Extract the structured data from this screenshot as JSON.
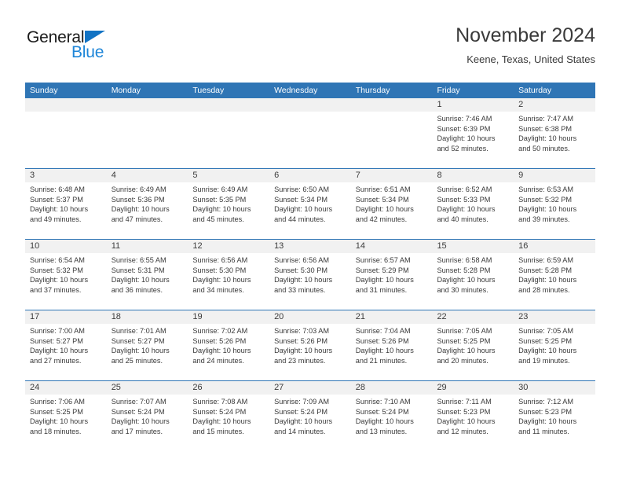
{
  "brand": {
    "name_dark": "General",
    "name_blue": "Blue",
    "triangle_color": "#1273c4",
    "blue_text_color": "#1f86d8"
  },
  "header": {
    "title": "November 2024",
    "subtitle": "Keene, Texas, United States"
  },
  "theme": {
    "header_blue": "#2f75b5",
    "day_band_gray": "#f1f1f1",
    "text_color": "#3a3a3a"
  },
  "weekday_headers": [
    "Sunday",
    "Monday",
    "Tuesday",
    "Wednesday",
    "Thursday",
    "Friday",
    "Saturday"
  ],
  "labels": {
    "sunrise_prefix": "Sunrise: ",
    "sunset_prefix": "Sunset: ",
    "daylight_prefix": "Daylight: "
  },
  "weeks": [
    [
      {
        "day": "",
        "empty": true
      },
      {
        "day": "",
        "empty": true
      },
      {
        "day": "",
        "empty": true
      },
      {
        "day": "",
        "empty": true
      },
      {
        "day": "",
        "empty": true
      },
      {
        "day": "1",
        "sunrise": "Sunrise: 7:46 AM",
        "sunset": "Sunset: 6:39 PM",
        "daylight": "Daylight: 10 hours and 52 minutes."
      },
      {
        "day": "2",
        "sunrise": "Sunrise: 7:47 AM",
        "sunset": "Sunset: 6:38 PM",
        "daylight": "Daylight: 10 hours and 50 minutes."
      }
    ],
    [
      {
        "day": "3",
        "sunrise": "Sunrise: 6:48 AM",
        "sunset": "Sunset: 5:37 PM",
        "daylight": "Daylight: 10 hours and 49 minutes."
      },
      {
        "day": "4",
        "sunrise": "Sunrise: 6:49 AM",
        "sunset": "Sunset: 5:36 PM",
        "daylight": "Daylight: 10 hours and 47 minutes."
      },
      {
        "day": "5",
        "sunrise": "Sunrise: 6:49 AM",
        "sunset": "Sunset: 5:35 PM",
        "daylight": "Daylight: 10 hours and 45 minutes."
      },
      {
        "day": "6",
        "sunrise": "Sunrise: 6:50 AM",
        "sunset": "Sunset: 5:34 PM",
        "daylight": "Daylight: 10 hours and 44 minutes."
      },
      {
        "day": "7",
        "sunrise": "Sunrise: 6:51 AM",
        "sunset": "Sunset: 5:34 PM",
        "daylight": "Daylight: 10 hours and 42 minutes."
      },
      {
        "day": "8",
        "sunrise": "Sunrise: 6:52 AM",
        "sunset": "Sunset: 5:33 PM",
        "daylight": "Daylight: 10 hours and 40 minutes."
      },
      {
        "day": "9",
        "sunrise": "Sunrise: 6:53 AM",
        "sunset": "Sunset: 5:32 PM",
        "daylight": "Daylight: 10 hours and 39 minutes."
      }
    ],
    [
      {
        "day": "10",
        "sunrise": "Sunrise: 6:54 AM",
        "sunset": "Sunset: 5:32 PM",
        "daylight": "Daylight: 10 hours and 37 minutes."
      },
      {
        "day": "11",
        "sunrise": "Sunrise: 6:55 AM",
        "sunset": "Sunset: 5:31 PM",
        "daylight": "Daylight: 10 hours and 36 minutes."
      },
      {
        "day": "12",
        "sunrise": "Sunrise: 6:56 AM",
        "sunset": "Sunset: 5:30 PM",
        "daylight": "Daylight: 10 hours and 34 minutes."
      },
      {
        "day": "13",
        "sunrise": "Sunrise: 6:56 AM",
        "sunset": "Sunset: 5:30 PM",
        "daylight": "Daylight: 10 hours and 33 minutes."
      },
      {
        "day": "14",
        "sunrise": "Sunrise: 6:57 AM",
        "sunset": "Sunset: 5:29 PM",
        "daylight": "Daylight: 10 hours and 31 minutes."
      },
      {
        "day": "15",
        "sunrise": "Sunrise: 6:58 AM",
        "sunset": "Sunset: 5:28 PM",
        "daylight": "Daylight: 10 hours and 30 minutes."
      },
      {
        "day": "16",
        "sunrise": "Sunrise: 6:59 AM",
        "sunset": "Sunset: 5:28 PM",
        "daylight": "Daylight: 10 hours and 28 minutes."
      }
    ],
    [
      {
        "day": "17",
        "sunrise": "Sunrise: 7:00 AM",
        "sunset": "Sunset: 5:27 PM",
        "daylight": "Daylight: 10 hours and 27 minutes."
      },
      {
        "day": "18",
        "sunrise": "Sunrise: 7:01 AM",
        "sunset": "Sunset: 5:27 PM",
        "daylight": "Daylight: 10 hours and 25 minutes."
      },
      {
        "day": "19",
        "sunrise": "Sunrise: 7:02 AM",
        "sunset": "Sunset: 5:26 PM",
        "daylight": "Daylight: 10 hours and 24 minutes."
      },
      {
        "day": "20",
        "sunrise": "Sunrise: 7:03 AM",
        "sunset": "Sunset: 5:26 PM",
        "daylight": "Daylight: 10 hours and 23 minutes."
      },
      {
        "day": "21",
        "sunrise": "Sunrise: 7:04 AM",
        "sunset": "Sunset: 5:26 PM",
        "daylight": "Daylight: 10 hours and 21 minutes."
      },
      {
        "day": "22",
        "sunrise": "Sunrise: 7:05 AM",
        "sunset": "Sunset: 5:25 PM",
        "daylight": "Daylight: 10 hours and 20 minutes."
      },
      {
        "day": "23",
        "sunrise": "Sunrise: 7:05 AM",
        "sunset": "Sunset: 5:25 PM",
        "daylight": "Daylight: 10 hours and 19 minutes."
      }
    ],
    [
      {
        "day": "24",
        "sunrise": "Sunrise: 7:06 AM",
        "sunset": "Sunset: 5:25 PM",
        "daylight": "Daylight: 10 hours and 18 minutes."
      },
      {
        "day": "25",
        "sunrise": "Sunrise: 7:07 AM",
        "sunset": "Sunset: 5:24 PM",
        "daylight": "Daylight: 10 hours and 17 minutes."
      },
      {
        "day": "26",
        "sunrise": "Sunrise: 7:08 AM",
        "sunset": "Sunset: 5:24 PM",
        "daylight": "Daylight: 10 hours and 15 minutes."
      },
      {
        "day": "27",
        "sunrise": "Sunrise: 7:09 AM",
        "sunset": "Sunset: 5:24 PM",
        "daylight": "Daylight: 10 hours and 14 minutes."
      },
      {
        "day": "28",
        "sunrise": "Sunrise: 7:10 AM",
        "sunset": "Sunset: 5:24 PM",
        "daylight": "Daylight: 10 hours and 13 minutes."
      },
      {
        "day": "29",
        "sunrise": "Sunrise: 7:11 AM",
        "sunset": "Sunset: 5:23 PM",
        "daylight": "Daylight: 10 hours and 12 minutes."
      },
      {
        "day": "30",
        "sunrise": "Sunrise: 7:12 AM",
        "sunset": "Sunset: 5:23 PM",
        "daylight": "Daylight: 10 hours and 11 minutes."
      }
    ]
  ]
}
